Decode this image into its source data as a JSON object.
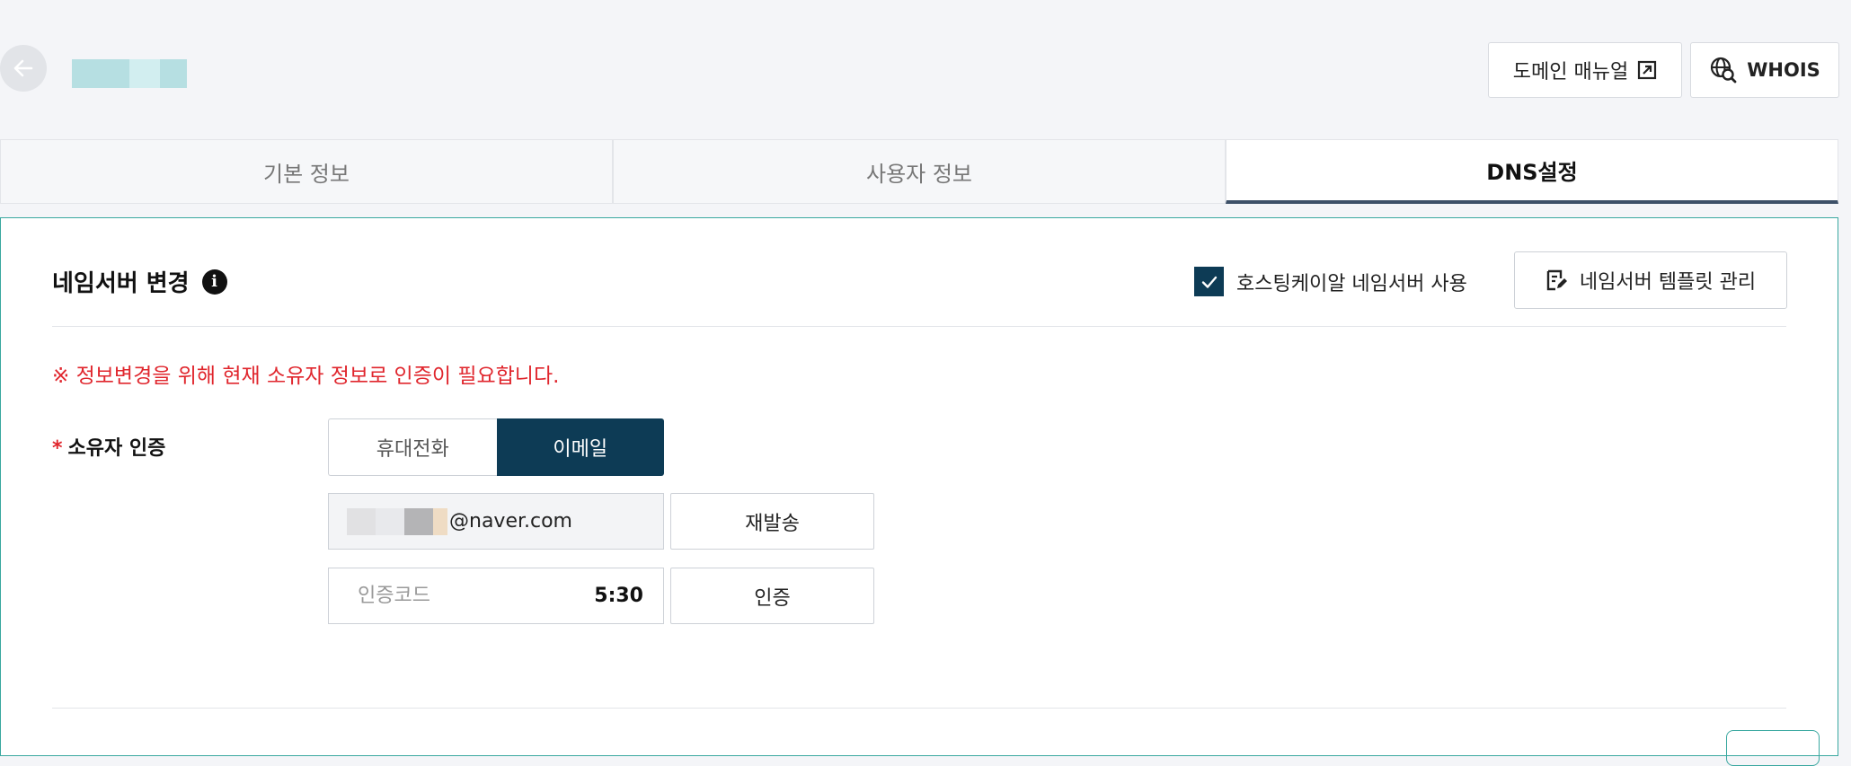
{
  "header": {
    "manual_label": "도메인 매뉴얼",
    "whois_label": "WHOIS",
    "icons": {
      "back": "arrow-left-icon",
      "manual": "external-link-icon",
      "whois": "globe-search-icon"
    }
  },
  "tabs": [
    {
      "label": "기본 정보",
      "active": false
    },
    {
      "label": "사용자 정보",
      "active": false
    },
    {
      "label": "DNS설정",
      "active": true
    }
  ],
  "section": {
    "title": "네임서버 변경",
    "hosting_ns_checkbox_label": "호스팅케이알 네임서버 사용",
    "hosting_ns_checked": true,
    "template_button_label": "네임서버 템플릿 관리",
    "notice": "※ 정보변경을 위해 현재 소유자 정보로 인증이 필요합니다."
  },
  "auth": {
    "label": "소유자 인증",
    "required_mark": "*",
    "options": [
      {
        "label": "휴대전화",
        "selected": false
      },
      {
        "label": "이메일",
        "selected": true
      }
    ],
    "email_suffix": "@naver.com",
    "resend_label": "재발송",
    "code_placeholder": "인증코드",
    "timer": "5:30",
    "verify_label": "인증"
  },
  "colors": {
    "primary": "#0d3b55",
    "accent_border": "#3aa8a0",
    "notice": "#e0262d",
    "active_tab_underline": "#3d5068"
  }
}
